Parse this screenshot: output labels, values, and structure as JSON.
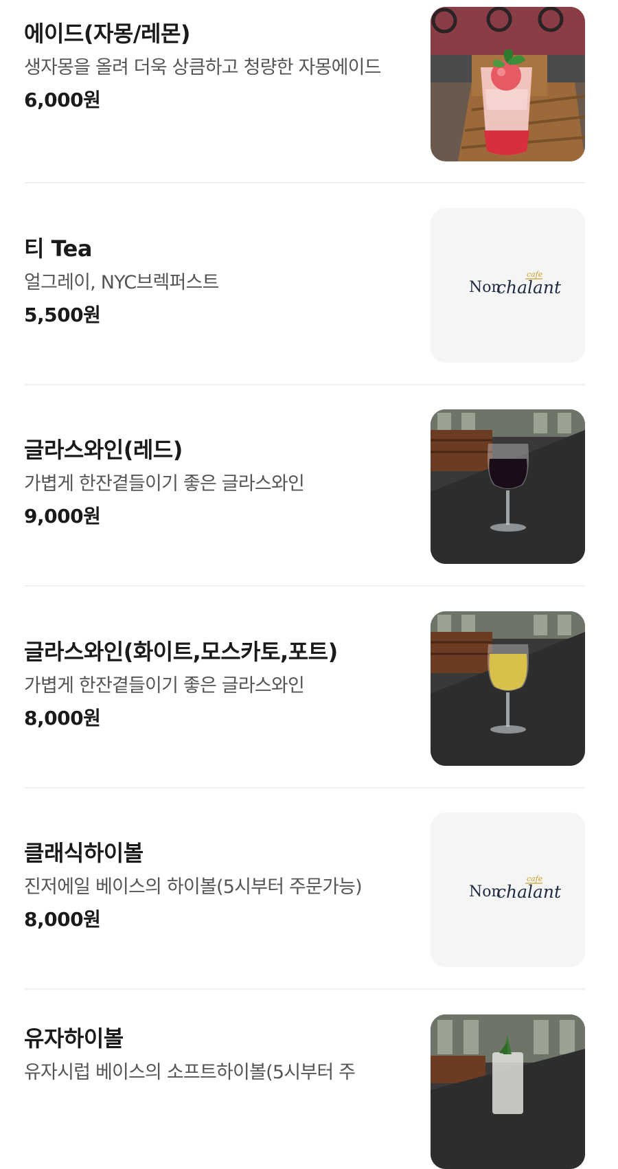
{
  "items": [
    {
      "name": "에이드(자몽/레몬)",
      "desc": "생자몽을 올려 더욱 상큼하고 청량한 자몽에이드",
      "price": "6,000원",
      "image": "grapefruit-ade-photo"
    },
    {
      "name": "티 Tea",
      "desc": "얼그레이, NYC브렉퍼스트",
      "price": "5,500원",
      "image": "nonchalant-logo"
    },
    {
      "name": "글라스와인(레드)",
      "desc": "가볍게 한잔곁들이기 좋은 글라스와인",
      "price": "9,000원",
      "image": "red-wine-photo"
    },
    {
      "name": "글라스와인(화이트,모스카토,포트)",
      "desc": "가볍게 한잔곁들이기 좋은 글라스와인",
      "price": "8,000원",
      "image": "white-wine-photo"
    },
    {
      "name": "클래식하이볼",
      "desc": "진저에일 베이스의 하이볼(5시부터 주문가능)",
      "price": "8,000원",
      "image": "nonchalant-logo"
    },
    {
      "name": "유자하이볼",
      "desc": "유자시럽 베이스의 소프트하이볼(5시부터 주",
      "price": "",
      "image": "yuja-highball-photo"
    }
  ],
  "logo": {
    "word1": "Non",
    "word2": "chalant",
    "tag": "cafe",
    "tag_color": "#c8a02a",
    "text_color": "#1f2a44"
  },
  "colors": {
    "text": "#1a1a1a",
    "desc": "#555555",
    "divider": "#f1f1f1",
    "placeholder_bg": "#f5f5f5"
  }
}
